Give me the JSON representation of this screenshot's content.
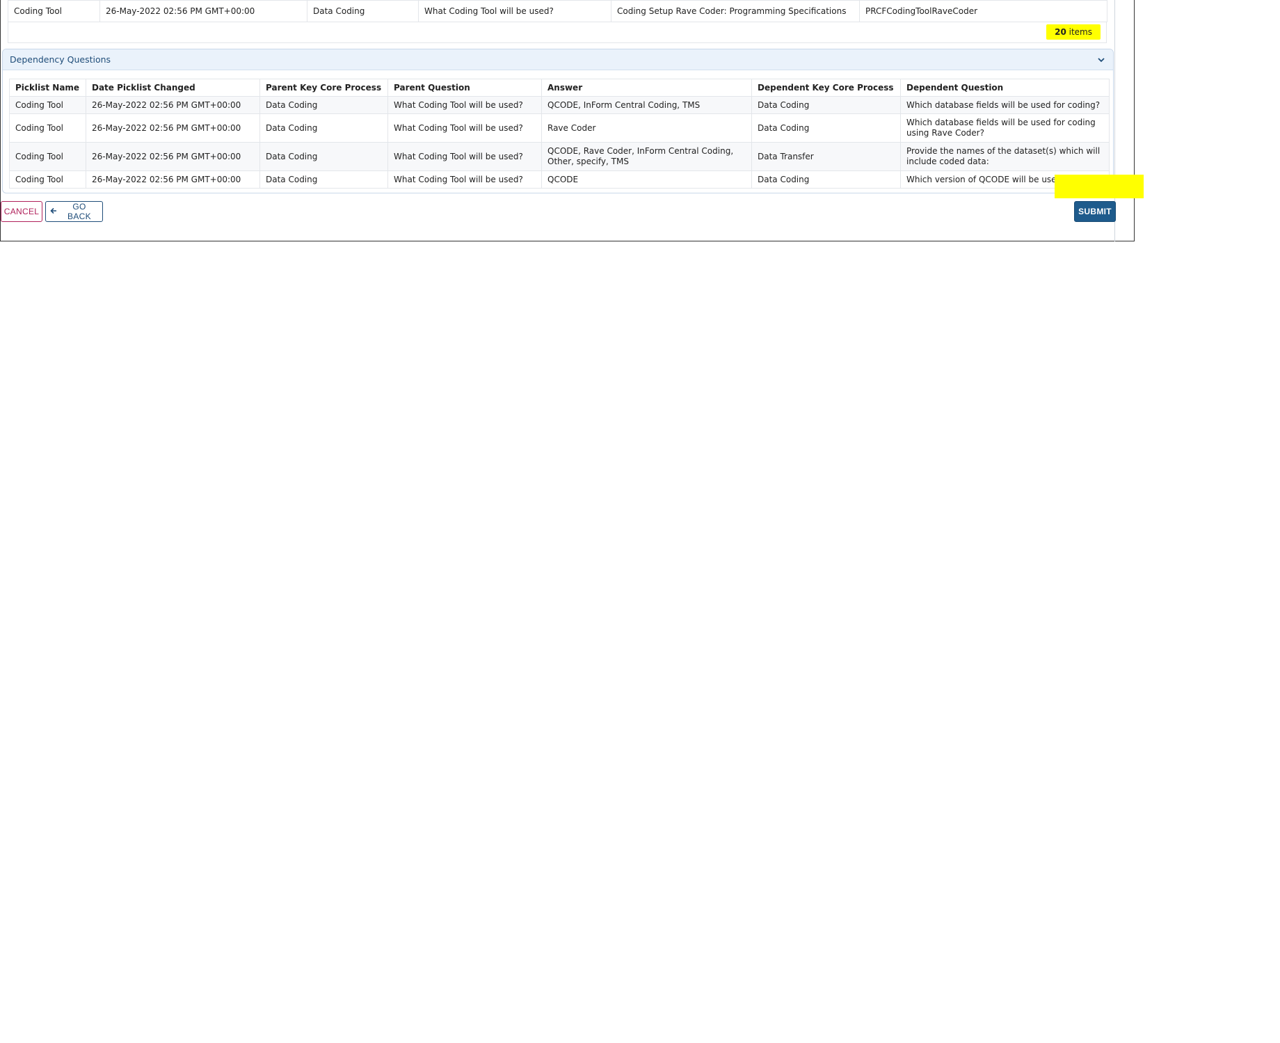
{
  "top_table": {
    "row": [
      "Coding Tool",
      "26-May-2022 02:56 PM  GMT+00:00",
      "Data Coding",
      "What Coding Tool will be used?",
      "Coding Setup Rave Coder: Programming Specifications",
      "PRCFCodingToolRaveCoder"
    ],
    "items_count": "20",
    "items_label": " items"
  },
  "dependency": {
    "title": "Dependency Questions",
    "headers": [
      "Picklist Name",
      "Date Picklist Changed",
      "Parent Key Core Process",
      "Parent Question",
      "Answer",
      "Dependent Key Core Process",
      "Dependent Question"
    ],
    "rows": [
      [
        "Coding Tool",
        "26-May-2022 02:56 PM  GMT+00:00",
        "Data Coding",
        "What Coding Tool will be used?",
        "QCODE, InForm Central Coding, TMS",
        "Data Coding",
        "Which database fields will be used for coding?"
      ],
      [
        "Coding Tool",
        "26-May-2022 02:56 PM  GMT+00:00",
        "Data Coding",
        "What Coding Tool will be used?",
        "Rave Coder",
        "Data Coding",
        "Which database fields will be used for coding using Rave Coder?"
      ],
      [
        "Coding Tool",
        "26-May-2022 02:56 PM  GMT+00:00",
        "Data Coding",
        "What Coding Tool will be used?",
        "QCODE, Rave Coder, InForm Central Coding, Other, specify, TMS",
        "Data Transfer",
        "Provide the names of the dataset(s) which will include coded data:"
      ],
      [
        "Coding Tool",
        "26-May-2022 02:56 PM  GMT+00:00",
        "Data Coding",
        "What Coding Tool will be used?",
        "QCODE",
        "Data Coding",
        "Which version of QCODE will be used?"
      ]
    ]
  },
  "actions": {
    "cancel": "CANCEL",
    "go_back": "GO BACK",
    "submit": "SUBMIT"
  },
  "colors": {
    "accent": "#1e5b8c",
    "cancel": "#b0205a",
    "highlight": "#ffff00",
    "panel_header_bg": "#eaf2fb"
  },
  "icons": {
    "panel_toggle": "chevron-down-icon",
    "back": "arrow-left-icon"
  }
}
